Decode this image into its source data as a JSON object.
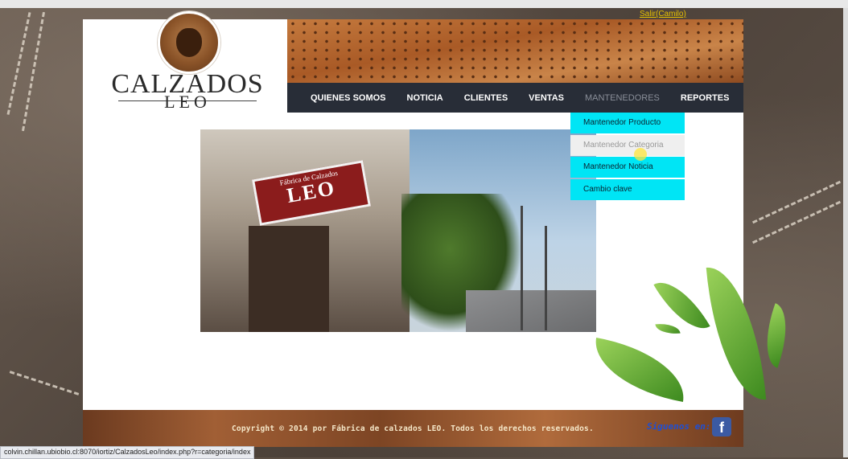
{
  "header": {
    "logout_link": "Salir(Camilo)",
    "brand_title": "CALZADOS",
    "brand_subtitle": "LEO"
  },
  "nav": {
    "items": [
      {
        "label": "QUIENES SOMOS"
      },
      {
        "label": "NOTICIA"
      },
      {
        "label": "CLIENTES"
      },
      {
        "label": "VENTAS"
      },
      {
        "label": "MANTENEDORES"
      },
      {
        "label": "REPORTES"
      }
    ],
    "active_index": 4
  },
  "dropdown": {
    "items": [
      {
        "label": "Mantenedor Producto"
      },
      {
        "label": "Mantenedor Categoria"
      },
      {
        "label": "Mantenedor Noticia"
      },
      {
        "label": "Cambio clave"
      }
    ],
    "hover_index": 1,
    "accent_color": "#00e5f5"
  },
  "photo": {
    "sign_line1": "Fábrica de Calzados",
    "sign_line2": "LEO"
  },
  "footer": {
    "copyright": "Copyright © 2014 por Fábrica de calzados LEO. Todos los derechos reservados.",
    "follow_label": "Siguenos en:",
    "social_icon": "facebook-icon"
  },
  "status_bar": {
    "url": "colvin.chillan.ubiobio.cl:8070/iortiz/CalzadosLeo/index.php?r=categoria/index"
  },
  "colors": {
    "navbar": "#282d37",
    "page_background": "#ffffff"
  }
}
